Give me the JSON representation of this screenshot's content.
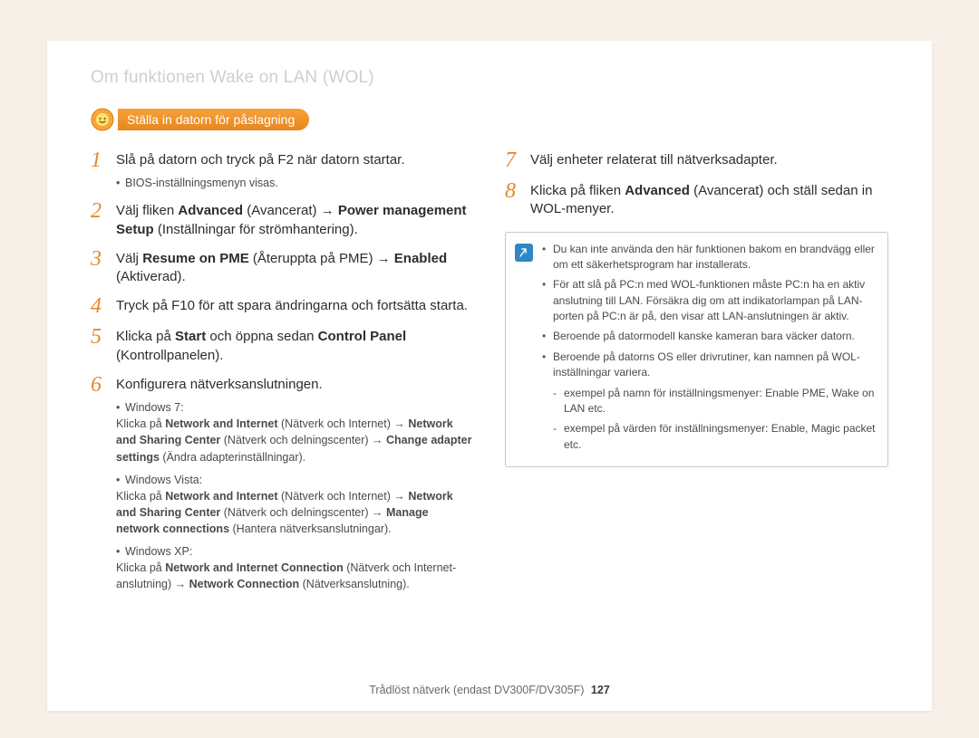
{
  "header": "Om funktionen Wake on LAN (WOL)",
  "pill": "Ställa in datorn för påslagning",
  "left_steps": [
    {
      "n": "1",
      "body": "Slå på datorn och tryck på F2 när datorn startar.",
      "sub_plain": [
        "BIOS-inställningsmenyn visas."
      ]
    },
    {
      "n": "2",
      "body_html": "Välj fliken <b>Advanced</b> (Avancerat) → <b>Power management Setup</b> (Inställningar för strömhantering)."
    },
    {
      "n": "3",
      "body_html": "Välj <b>Resume on PME</b> (Återuppta på PME) → <b>Enabled</b> (Aktiverad)."
    },
    {
      "n": "4",
      "body": "Tryck på F10 för att spara ändringarna och fortsätta starta."
    },
    {
      "n": "5",
      "body_html": "Klicka på <b>Start</b> och öppna sedan <b>Control Panel</b> (Kontrollpanelen)."
    },
    {
      "n": "6",
      "body": "Konfigurera nätverksanslutningen.",
      "sub_html": [
        "Windows 7:<br>Klicka på <b>Network and Internet</b> (Nätverk och Internet) → <b>Network and Sharing Center</b> (Nätverk och delningscenter) → <b>Change adapter settings</b> (Ändra adapterinställningar).",
        "Windows Vista:<br>Klicka på <b>Network and Internet</b> (Nätverk och Internet) → <b>Network and Sharing Center</b> (Nätverk och delningscenter) → <b>Manage network connections</b> (Hantera nätverksanslutningar).",
        "Windows XP:<br>Klicka på <b>Network and Internet Connection</b> (Nätverk och Internet-anslutning) → <b>Network Connection</b> (Nätverksanslutning)."
      ]
    }
  ],
  "right_steps": [
    {
      "n": "7",
      "body": "Välj enheter relaterat till nätverksadapter."
    },
    {
      "n": "8",
      "body_html": "Klicka på fliken <b>Advanced</b> (Avancerat) och ställ sedan in WOL-menyer."
    }
  ],
  "notes": [
    "Du kan inte använda den här funktionen bakom en brandvägg eller om ett säkerhetsprogram har installerats.",
    "För att slå på PC:n med WOL-funktionen måste PC:n ha en aktiv anslutning till LAN. Försäkra dig om att indikatorlampan på LAN-porten på PC:n är på, den visar att LAN-anslutningen är aktiv.",
    "Beroende på datormodell kanske kameran bara väcker datorn.",
    "Beroende på datorns OS eller drivrutiner, kan namnen på WOL-inställningar variera."
  ],
  "notes_sub": [
    "exempel på namn för inställningsmenyer: Enable PME, Wake on LAN etc.",
    "exempel på värden för inställningsmenyer: Enable, Magic packet etc."
  ],
  "footer_text": "Trådlöst nätverk (endast DV300F/DV305F)",
  "page_number": "127"
}
